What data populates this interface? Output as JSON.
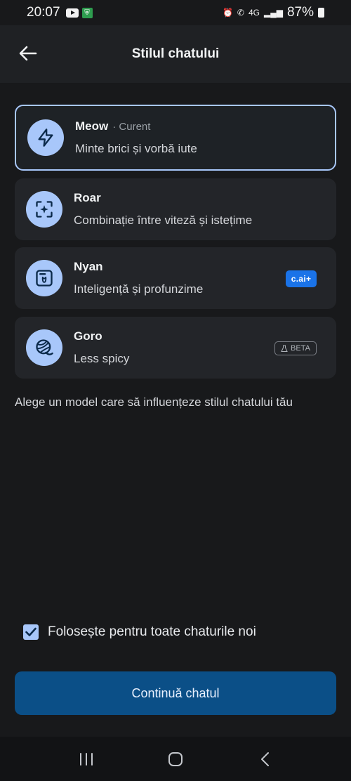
{
  "status_bar": {
    "time": "20:07",
    "battery": "87%",
    "network": "4G"
  },
  "header": {
    "title": "Stilul chatului"
  },
  "models": [
    {
      "name": "Meow",
      "current": "· Curent",
      "description": "Minte brici și vorbă iute",
      "icon": "lightning-icon",
      "selected": true
    },
    {
      "name": "Roar",
      "description": "Combinație între viteză și istețime",
      "icon": "sparkle-frame-icon"
    },
    {
      "name": "Nyan",
      "description": "Inteligență și profunzime",
      "icon": "cat-note-icon",
      "badge": "c.ai+"
    },
    {
      "name": "Goro",
      "description": "Less spicy",
      "icon": "yarn-ball-icon",
      "badge": "BETA"
    }
  ],
  "hint": "Alege un model care să influențeze stilul chatului tău",
  "checkbox": {
    "label": "Folosește pentru toate chaturile noi",
    "checked": true
  },
  "continue_button": "Continuă chatul",
  "colors": {
    "accent": "#a8c7fa",
    "button": "#0b4f87",
    "background": "#18191b"
  }
}
